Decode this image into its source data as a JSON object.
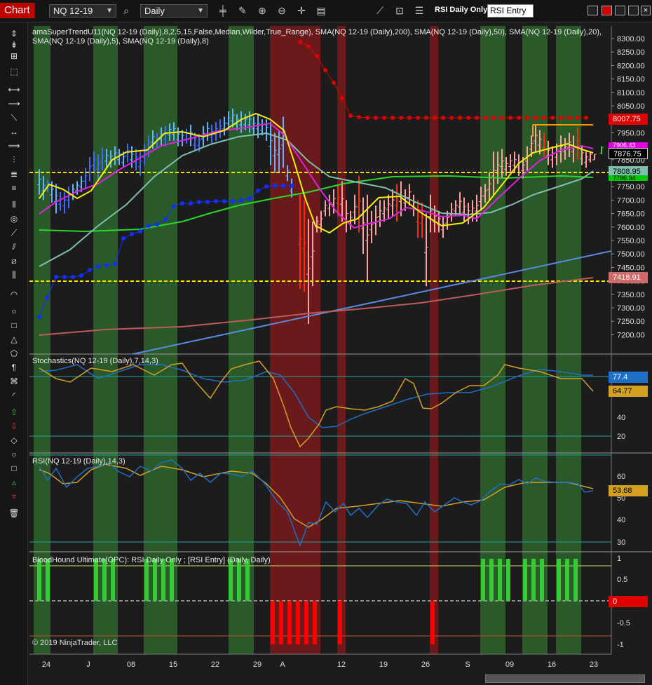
{
  "toolbar": {
    "title": "Chart",
    "instrument": "NQ 12-19",
    "timeframe": "Daily",
    "strategy_label": "RSI Daily Only",
    "strategy_entry": "RSI Entry",
    "icons": [
      "search-icon",
      "bar-type-icon",
      "draw-icon",
      "zoom-in-icon",
      "zoom-out-icon",
      "crosshair-icon",
      "data-box-icon",
      "strategy-icon",
      "indicator-icon",
      "properties-icon"
    ]
  },
  "panels": {
    "price": {
      "title": "amaSuperTrendU11(NQ 12-19 (Daily),8,2.5,15,False,Median,Wilder,True_Range), SMA(NQ 12-19 (Daily),200), SMA(NQ 12-19 (Daily),50), SMA(NQ 12-19 (Daily),20), SMA(NQ 12-19 (Daily),5), SMA(NQ 12-19 (Daily),8)",
      "axis_ticks": [
        "8300.00",
        "8250.00",
        "8200.00",
        "8150.00",
        "8100.00",
        "8050.00",
        "8000.00",
        "7950.00",
        "7900.00",
        "7850.00",
        "7800.00",
        "7750.00",
        "7700.00",
        "7650.00",
        "7600.00",
        "7550.00",
        "7500.00",
        "7450.00",
        "7400.00",
        "7350.00",
        "7300.00",
        "7250.00",
        "7200.00"
      ],
      "tags": [
        {
          "label": "8007.75",
          "color": "#e00000"
        },
        {
          "label": "7906.43",
          "color": "#e000e0"
        },
        {
          "label": "7876.75",
          "color": "#000000"
        },
        {
          "label": "7808.95",
          "color": "#7fbfae"
        },
        {
          "label": "7786.94",
          "color": "#00cc00"
        },
        {
          "label": "7418.91",
          "color": "#d06a6a"
        }
      ]
    },
    "stochastics": {
      "title": "Stochastics(NQ 12-19 (Daily),7,14,3)",
      "axis_ticks": [
        "60",
        "40",
        "20"
      ],
      "tags": [
        {
          "label": "77.4",
          "color": "#1e6fc8"
        },
        {
          "label": "64.77",
          "color": "#d4a020"
        }
      ]
    },
    "rsi": {
      "title": "RSI(NQ 12-19 (Daily),14,3)",
      "axis_ticks": [
        "60",
        "50",
        "40",
        "30"
      ],
      "tags": [
        {
          "label": "53.68",
          "color": "#d4a020"
        }
      ]
    },
    "bloodhound": {
      "title": "BloodHound Ultimate(OPC): RSI Daily Only ; [RSI Entry] (Daily, Daily)",
      "axis_ticks": [
        "1",
        "0.5",
        "0",
        "-0.5",
        "-1"
      ],
      "tags": [
        {
          "label": "0",
          "color": "#e00000"
        }
      ],
      "signals_up": [
        1,
        1,
        1,
        1,
        1,
        1,
        1,
        1,
        1,
        1,
        1,
        1,
        1,
        1,
        1,
        1,
        1,
        1,
        1,
        1,
        1,
        1,
        1,
        1,
        1
      ],
      "signals_down": [
        1,
        1,
        1,
        1,
        1,
        1,
        1,
        1,
        1,
        1,
        1,
        1
      ]
    }
  },
  "x_axis": {
    "labels": [
      "24",
      "J",
      "08",
      "15",
      "22",
      "29",
      "A",
      "12",
      "19",
      "26",
      "S",
      "09",
      "16",
      "23"
    ]
  },
  "copyright": "© 2019 NinjaTrader, LLC",
  "colors": {
    "background": "#1c1c1c",
    "green_band": "#2a5a2a",
    "red_band": "#6a1a1a",
    "accent_red": "#c00000"
  }
}
